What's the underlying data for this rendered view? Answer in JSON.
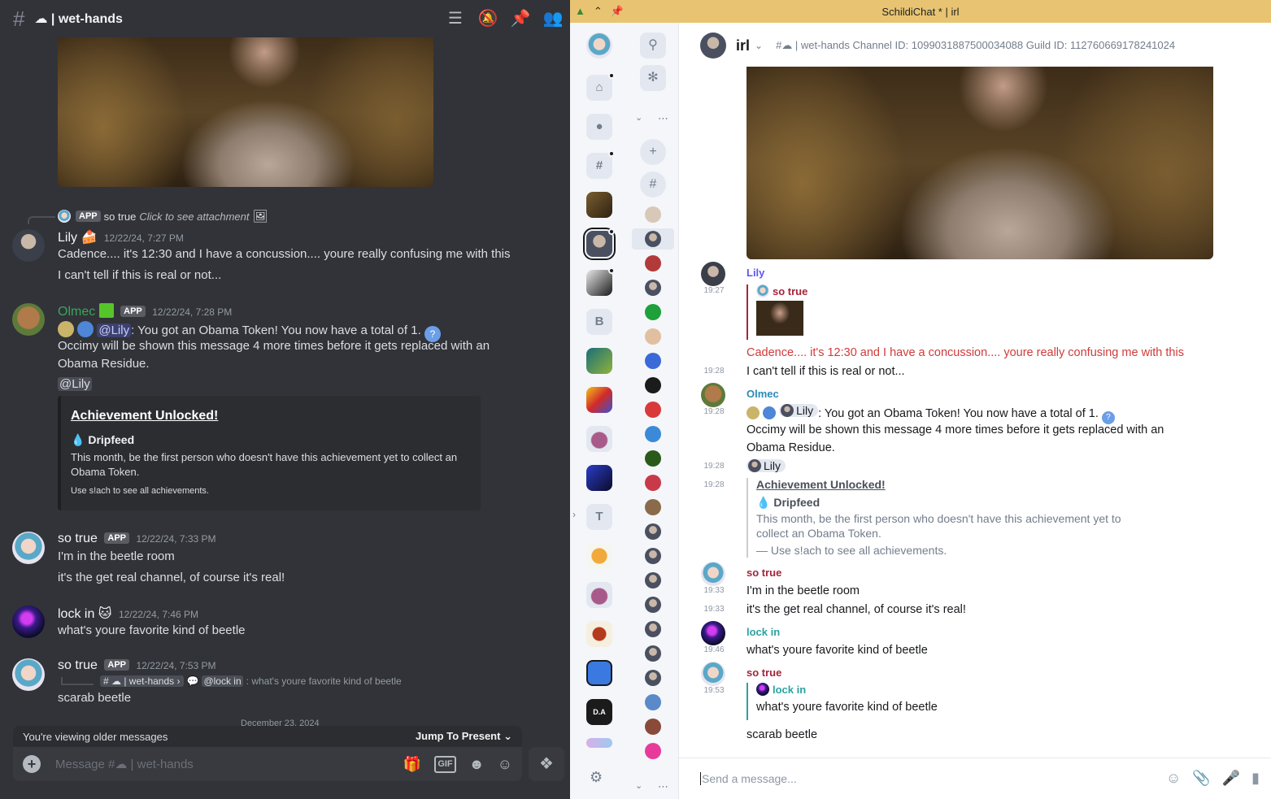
{
  "discord": {
    "channel": "☁ | wet-hands",
    "reply1": {
      "text": "so true",
      "attach": "Click to see attachment"
    },
    "lily": {
      "name": "Lily",
      "time": "12/22/24, 7:27 PM",
      "line1": "Cadence.... it's 12:30 and I have a concussion.... youre really confusing me with this",
      "line2": "I can't tell if this is real or not..."
    },
    "olmec": {
      "name": "Olmec",
      "time": "12/22/24, 7:28 PM",
      "mention": "@Lily",
      "line1": ": You got an Obama Token! You now have a total of 1.",
      "line2": "Occimy will be shown this message 4 more times before it gets replaced with an",
      "line3": "Obama Residue.",
      "mention2": "@Lily"
    },
    "embed": {
      "title": "Achievement Unlocked!",
      "subtitle": "Dripfeed",
      "desc": "This month, be the first person who doesn't have this achievement yet to collect an Obama Token.",
      "footer": "Use s!ach to see all achievements."
    },
    "sotrue1": {
      "name": "so true",
      "time": "12/22/24, 7:33 PM",
      "line1": "I'm in the beetle room",
      "line2": "it's the get real channel, of course it's real!"
    },
    "lockin": {
      "name": "lock in",
      "time": "12/22/24, 7:46 PM",
      "line1": "what's youre favorite kind of beetle"
    },
    "sotrue2": {
      "name": "so true",
      "time": "12/22/24, 7:53 PM",
      "reply_channel": "# ☁ | wet-hands ›",
      "reply_mention": "@lock in",
      "reply_text": ": what's youre favorite kind of beetle",
      "line1": "scarab beetle"
    },
    "app_label": "APP",
    "date_divider": "December 23, 2024",
    "older": "You're viewing older messages",
    "jump": "Jump To Present",
    "composer_placeholder": "Message #☁ | wet-hands"
  },
  "schildi": {
    "window_title": "SchildiChat * | irl",
    "room_name": "irl",
    "room_topic": "#☁ | wet-hands Channel ID: 1099031887500034088 Guild ID: 1127606691782410​24",
    "room_topic_display": "#☁ | wet-hands Channel ID: 1099031887500034088 Guild ID: 112760669178241024",
    "lily_name": "Lily",
    "lily_time1": "19:27",
    "quote_name": "so true",
    "lily_line1": "Cadence.... it's 12:30 and I have a concussion.... youre really confusing me with this",
    "lily_time2": "19:28",
    "lily_line2": "I can't tell if this is real or not...",
    "olmec_name": "Olmec",
    "olmec_time1": "19:28",
    "olmec_mention": "Lily",
    "olmec_line1": ": You got an Obama Token! You now have a total of 1.",
    "olmec_line2": "Occimy will be shown this message 4 more times before it gets replaced with an",
    "olmec_line3": "Obama Residue.",
    "olmec_time2": "19:28",
    "olmec_pill": "Lily",
    "olmec_time3": "19:28",
    "embed_title": "Achievement Unlocked!",
    "embed_sub": "Dripfeed",
    "embed_desc1": "This month, be the first person who doesn't have this achievement yet to",
    "embed_desc2": "collect an Obama Token.",
    "embed_foot": "— Use s!ach to see all achievements.",
    "sotrue_name": "so true",
    "sotrue_time1": "19:33",
    "sotrue_line1": "I'm in the beetle room",
    "sotrue_time2": "19:33",
    "sotrue_line2": "it's the get real channel, of course it's real!",
    "lockin_name": "lock in",
    "lockin_time": "19:46",
    "lockin_line": "what's youre favorite kind of beetle",
    "sotrue2_name": "so true",
    "sotrue2_time": "19:53",
    "sotrue2_quote_name": "lock in",
    "sotrue2_quote_line": "what's youre favorite kind of beetle",
    "sotrue2_line": "scarab beetle",
    "composer_placeholder": "Send a message...",
    "space_b": "B",
    "space_t": "T"
  }
}
